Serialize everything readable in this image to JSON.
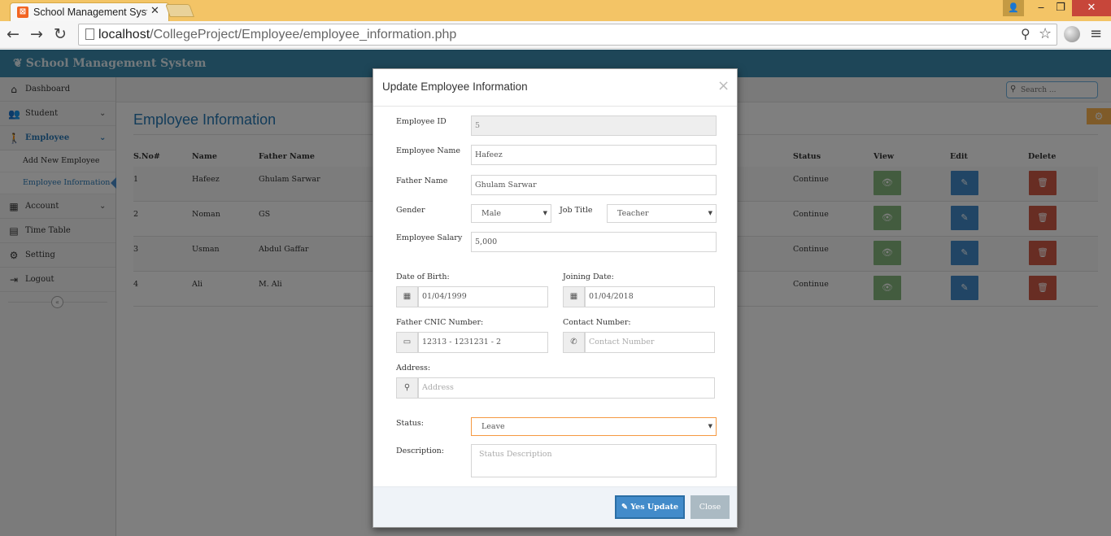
{
  "browser": {
    "tab_title": "School Management Syste",
    "tab_favicon": "xampp-icon",
    "url_host": "localhost",
    "url_path": "/CollegeProject/Employee/employee_information.php"
  },
  "app": {
    "brand": "School Management System",
    "accent": "#3d8db0"
  },
  "sidebar": {
    "items": [
      {
        "label": "Dashboard",
        "icon": "home-icon"
      },
      {
        "label": "Student",
        "icon": "users-icon"
      },
      {
        "label": "Employee",
        "icon": "person-icon"
      },
      {
        "label": "Account",
        "icon": "calculator-icon"
      },
      {
        "label": "Time Table",
        "icon": "calendar-icon"
      },
      {
        "label": "Setting",
        "icon": "gear-icon"
      },
      {
        "label": "Logout",
        "icon": "logout-icon"
      }
    ],
    "employee_sub": [
      {
        "label": "Add New Employee"
      },
      {
        "label": "Employee Information"
      }
    ]
  },
  "search": {
    "placeholder": "Search ..."
  },
  "page": {
    "title": "Employee Information"
  },
  "table": {
    "headers": {
      "sno": "S.No#",
      "name": "Name",
      "father": "Father Name",
      "status": "Status",
      "view": "View",
      "edit": "Edit",
      "delete": "Delete"
    },
    "rows": [
      {
        "sno": "1",
        "name": "Hafeez",
        "father": "Ghulam Sarwar",
        "status": "Continue"
      },
      {
        "sno": "2",
        "name": "Noman",
        "father": "GS",
        "status": "Continue"
      },
      {
        "sno": "3",
        "name": "Usman",
        "father": "Abdul Gaffar",
        "status": "Continue"
      },
      {
        "sno": "4",
        "name": "Ali",
        "father": "M. Ali",
        "status": "Continue"
      }
    ]
  },
  "modal": {
    "title": "Update Employee Information",
    "close_glyph": "×",
    "fields": {
      "employee_id": {
        "label": "Employee ID",
        "value": "5"
      },
      "employee_name": {
        "label": "Employee Name",
        "value": "Hafeez"
      },
      "father_name": {
        "label": "Father Name",
        "value": "Ghulam Sarwar"
      },
      "gender": {
        "label": "Gender",
        "value": "Male"
      },
      "job_title": {
        "label": "Job Title",
        "value": "Teacher"
      },
      "salary": {
        "label": "Employee Salary",
        "value": "5,000"
      },
      "dob": {
        "label": "Date of Birth:",
        "value": "01/04/1999"
      },
      "joining": {
        "label": "Joining Date:",
        "value": "01/04/2018"
      },
      "cnic": {
        "label": "Father CNIC Number:",
        "value": "12313 - 1231231 - 2"
      },
      "contact": {
        "label": "Contact Number:",
        "placeholder": "Contact Number"
      },
      "address": {
        "label": "Address:",
        "placeholder": "Address"
      },
      "status": {
        "label": "Status:",
        "value": "Leave"
      },
      "description": {
        "label": "Description:",
        "placeholder": "Status Description"
      }
    },
    "buttons": {
      "update": "Yes Update",
      "close": "Close"
    }
  }
}
